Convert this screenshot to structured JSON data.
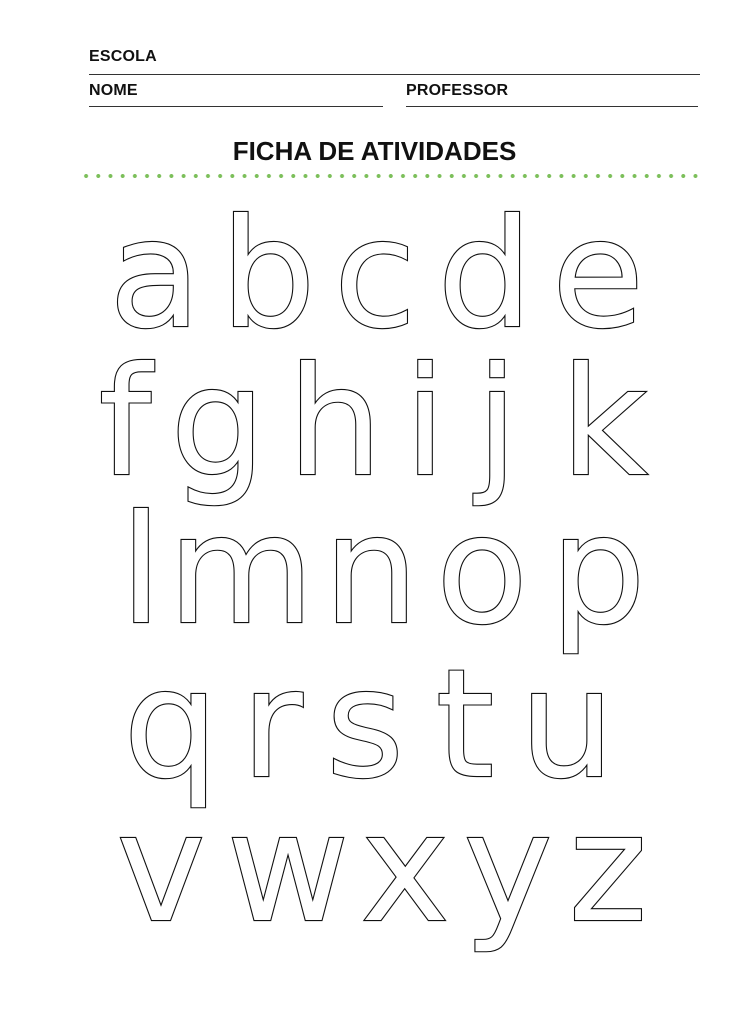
{
  "header": {
    "school_label": "ESCOLA",
    "name_label": "NOME",
    "teacher_label": "PROFESSOR"
  },
  "title": "FICHA DE ATIVIDADES",
  "accent_color": "#7cbf5a",
  "letters": [
    [
      "a",
      "b",
      "c",
      "d",
      "e"
    ],
    [
      "f",
      "g",
      "h",
      "i",
      "j",
      "k"
    ],
    [
      "l",
      "m",
      "n",
      "o",
      "p"
    ],
    [
      "q",
      "r",
      "s",
      "t",
      "u"
    ],
    [
      "v",
      "w",
      "x",
      "y",
      "z"
    ]
  ]
}
